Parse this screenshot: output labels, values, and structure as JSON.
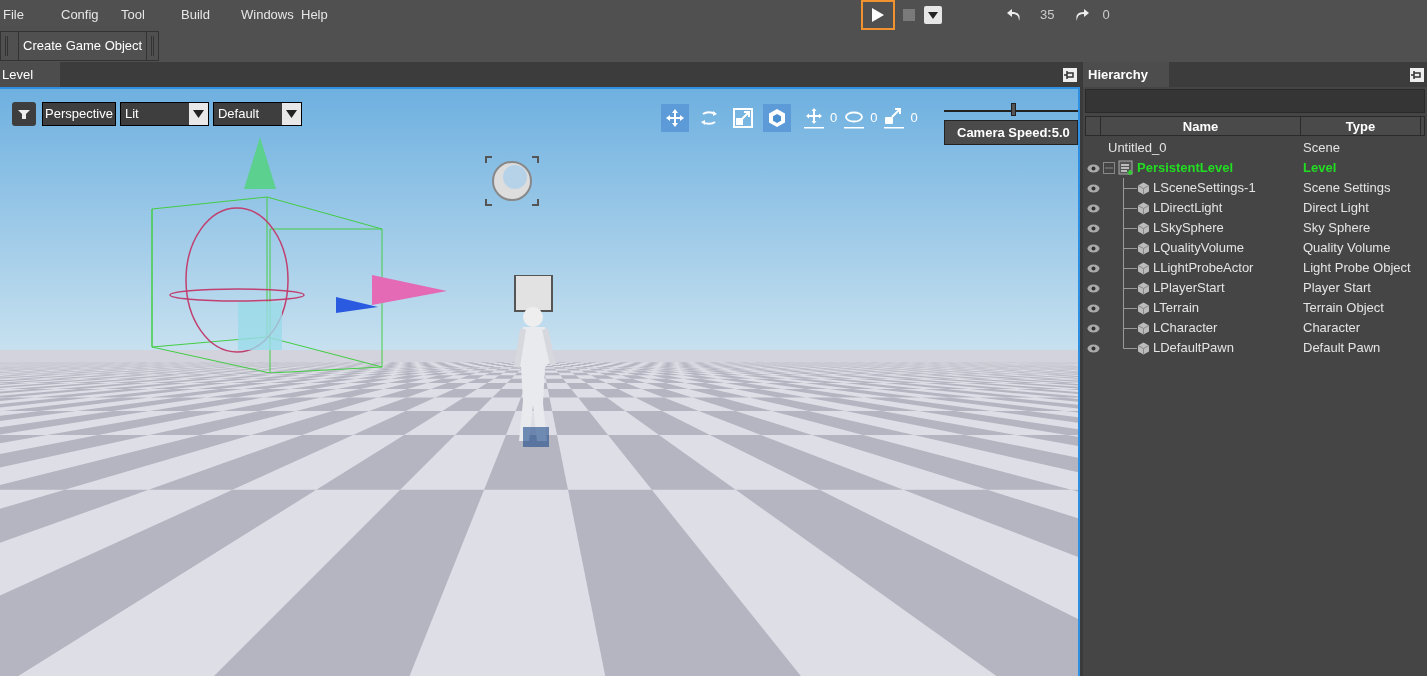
{
  "menu": [
    "File",
    "Config",
    "Tool",
    "Build",
    "Windows",
    "Help"
  ],
  "play_controls": {
    "play": {
      "selected": true
    },
    "stop": {
      "disabled": true
    },
    "undo_count": "35",
    "redo_count": "0"
  },
  "toolbar": {
    "button": "Create Game Object"
  },
  "level_panel": {
    "tab": "Level",
    "viewport": {
      "view_mode": "Perspective",
      "lighting": "Lit",
      "preset": "Default",
      "tools": [
        {
          "kind": "move",
          "selected": true
        },
        {
          "kind": "rotate",
          "selected": false
        },
        {
          "kind": "scale",
          "selected": false
        },
        {
          "kind": "space",
          "selected": true
        }
      ],
      "snaps": [
        {
          "kind": "move",
          "value": "0"
        },
        {
          "kind": "rotate",
          "value": "0"
        },
        {
          "kind": "scale",
          "value": "0"
        }
      ],
      "camera_speed": {
        "level": 0.5,
        "label": "Camera Speed:5.0"
      }
    }
  },
  "hierarchy": {
    "tab": "Hierarchy",
    "columns": [
      "Name",
      "Type"
    ],
    "root": {
      "name": "Untitled_0",
      "type": "Scene",
      "children": [
        {
          "name": "PersistentLevel",
          "type": "Level",
          "visible": true,
          "active": true,
          "expanded": true,
          "children": [
            {
              "name": "LSceneSettings-1",
              "type": "Scene Settings",
              "visible": true,
              "active": false
            },
            {
              "name": "LDirectLight",
              "type": "Direct Light",
              "visible": true,
              "active": false
            },
            {
              "name": "LSkySphere",
              "type": "Sky Sphere",
              "visible": true,
              "active": false
            },
            {
              "name": "LQualityVolume",
              "type": "Quality Volume",
              "visible": true,
              "active": false
            },
            {
              "name": "LLightProbeActor",
              "type": "Light Probe Object",
              "visible": true,
              "active": false
            },
            {
              "name": "LPlayerStart",
              "type": "Player Start",
              "visible": true,
              "active": false
            },
            {
              "name": "LTerrain",
              "type": "Terrain Object",
              "visible": true,
              "active": false
            },
            {
              "name": "LCharacter",
              "type": "Character",
              "visible": true,
              "active": false
            },
            {
              "name": "LDefaultPawn",
              "type": "Default Pawn",
              "visible": true,
              "active": false
            }
          ]
        }
      ]
    }
  }
}
